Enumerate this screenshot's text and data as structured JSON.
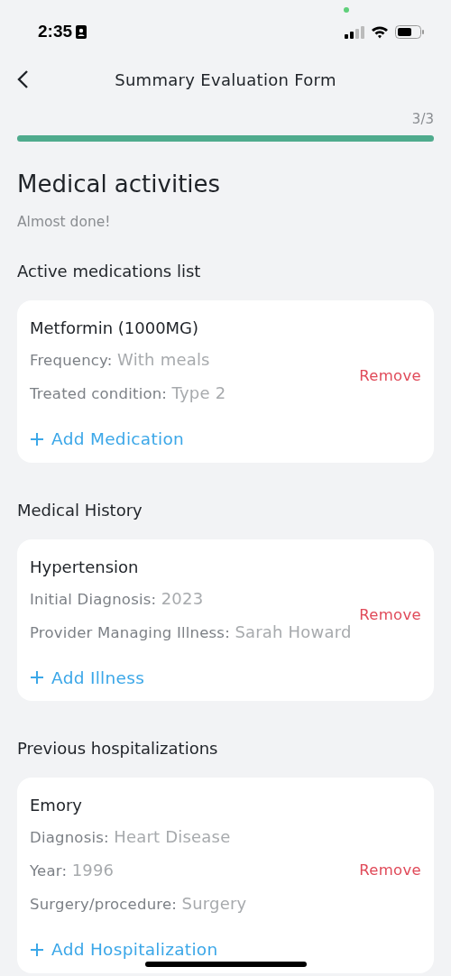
{
  "status_bar": {
    "time": "2:35"
  },
  "nav": {
    "title": "Summary Evaluation Form"
  },
  "progress": {
    "label": "3/3",
    "level": 1
  },
  "heading": "Medical activities",
  "subtitle": "Almost done!",
  "sections": [
    {
      "title": "Active medications list",
      "card": {
        "name": "Metformin (1000MG)",
        "fields": [
          {
            "label": "Frequency:",
            "value": "With meals"
          },
          {
            "label": "Treated condition:",
            "value": "Type 2"
          }
        ],
        "remove": "Remove",
        "add": "Add Medication"
      }
    },
    {
      "title": "Medical History",
      "card": {
        "name": "Hypertension",
        "fields": [
          {
            "label": "Initial Diagnosis:",
            "value": "2023"
          },
          {
            "label": "Provider Managing Illness:",
            "value": "Sarah Howard"
          }
        ],
        "remove": "Remove",
        "add": "Add Illness"
      }
    },
    {
      "title": "Previous hospitalizations",
      "card": {
        "name": "Emory",
        "fields": [
          {
            "label": "Diagnosis:",
            "value": "Heart Disease"
          },
          {
            "label": "Year:",
            "value": "1996"
          },
          {
            "label": "Surgery/procedure:",
            "value": "Surgery"
          }
        ],
        "remove": "Remove",
        "add": "Add Hospitalization"
      }
    }
  ]
}
